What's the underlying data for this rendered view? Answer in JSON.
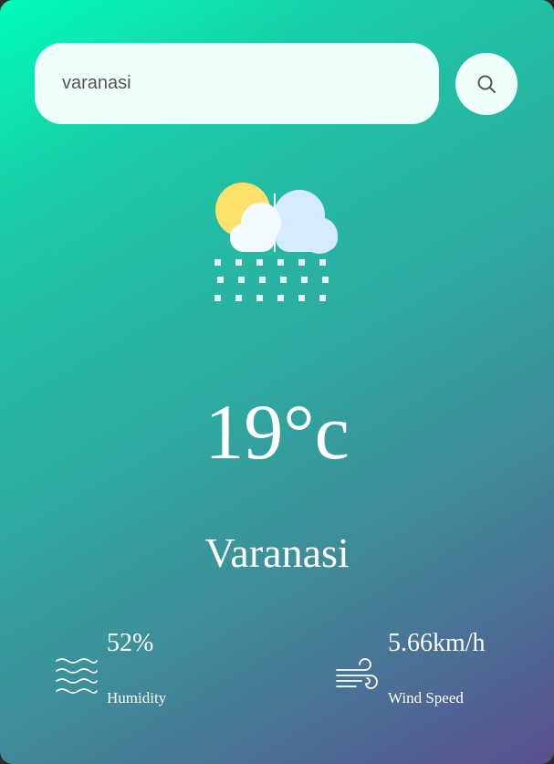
{
  "search": {
    "value": "varanasi",
    "button_icon": "search-icon"
  },
  "weather": {
    "icon": "rain-sun-cloud-icon",
    "temperature": "19°c",
    "city": "Varanasi"
  },
  "details": {
    "humidity": {
      "icon": "humidity-waves-icon",
      "value": "52%",
      "label": "Humidity"
    },
    "wind": {
      "icon": "wind-icon",
      "value": "5.66km/h",
      "label": "Wind Speed"
    }
  },
  "colors": {
    "gradient_start": "#00fcbb",
    "gradient_end": "#5a4f8e",
    "input_background": "#eefffc",
    "text": "#ffffff"
  }
}
